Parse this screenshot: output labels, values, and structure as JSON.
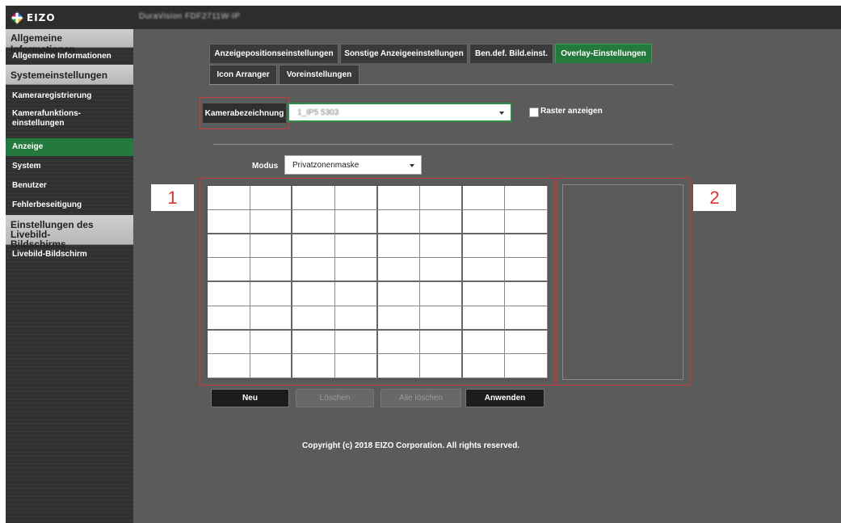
{
  "header": {
    "brand": "EIZO",
    "device_name": "DuraVision FDF2711W-IP"
  },
  "sidebar": {
    "sections": [
      {
        "title": "Allgemeine Informationen",
        "items": [
          "Allgemeine Informationen"
        ]
      },
      {
        "title": "Systemeinstellungen",
        "items": [
          "Kameraregistrierung",
          "Kamerafunktions-\neinstellungen",
          "Anzeige",
          "System",
          "Benutzer",
          "Fehlerbeseitigung"
        ]
      },
      {
        "title": "Einstellungen des Livebild-\nBildschirms",
        "items": [
          "Livebild-Bildschirm"
        ]
      }
    ],
    "active_item": "Anzeige"
  },
  "tabs": {
    "row1": [
      "Anzeigepositionseinstellungen",
      "Sonstige Anzeigeeinstellungen",
      "Ben.def. Bild.einst.",
      "Overlay-Einstellungen"
    ],
    "row2": [
      "Icon Arranger",
      "Voreinstellungen"
    ],
    "active": "Overlay-Einstellungen"
  },
  "camera": {
    "label": "Kamerabezeichnung",
    "selected": "1_IP5 5303",
    "grid_checkbox_label": "Raster anzeigen",
    "grid_checked": false
  },
  "mode": {
    "label": "Modus",
    "selected": "Privatzonenmaske"
  },
  "annotations": {
    "grid_number": "1",
    "preview_number": "2"
  },
  "buttons": {
    "new": "Neu",
    "delete": "Löschen",
    "delete_all": "Alle löschen",
    "apply": "Anwenden"
  },
  "footer": {
    "copyright": "Copyright (c) 2018 EIZO Corporation. All rights reserved."
  },
  "colors": {
    "accent_green": "#247a3c",
    "annotation_red": "#c83a3a"
  }
}
